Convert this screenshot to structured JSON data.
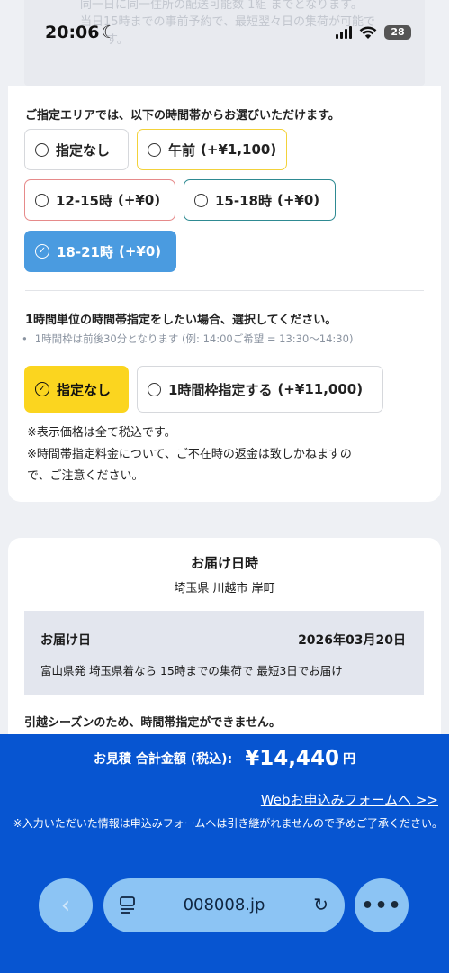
{
  "status_bar": {
    "time": "20:06",
    "moon_icon": "☾",
    "battery": "28"
  },
  "top_faded": {
    "line1": "同一日に同一住所の配送可能数 1組 までとなります。",
    "line2": "当日15時までの事前予約で、最短翌々日の集荷が可能で",
    "line3": "す。"
  },
  "area_time": {
    "heading": "ご指定エリアでは、以下の時間帯からお選びいただけます。",
    "options": [
      {
        "label": "指定なし",
        "price": "",
        "selected": false
      },
      {
        "label": "午前",
        "price": "(+¥1,100)",
        "selected": false
      },
      {
        "label": "12-15時",
        "price": "(+¥0)",
        "selected": false
      },
      {
        "label": "15-18時",
        "price": "(+¥0)",
        "selected": false
      },
      {
        "label": "18-21時",
        "price": "(+¥0)",
        "selected": true
      }
    ]
  },
  "hourly": {
    "heading": "1時間単位の時間帯指定をしたい場合、選択してください。",
    "hint": "1時間枠は前後30分となります (例: 14:00ご希望 = 13:30〜14:30)",
    "options": [
      {
        "label": "指定なし",
        "price": "",
        "selected": true
      },
      {
        "label": "1時間枠指定する",
        "price": "(+¥11,000)",
        "selected": false
      }
    ]
  },
  "notes": {
    "tax": "※表示価格は全て税込です。",
    "refund_line1": "※時間帯指定料金について、ご不在時の返金は致しかねますの",
    "refund_line2": "で、ご注意ください。"
  },
  "delivery": {
    "title": "お届け日時",
    "location": "埼玉県 川越市 岸町",
    "date_label": "お届け日",
    "date_value": "2026年03月20日",
    "date_sub": "富山県発 埼玉県着なら 15時までの集荷で 最短3日でお届け",
    "warning": "引越シーズンのため、時間帯指定ができません。"
  },
  "footer": {
    "total_label": "お見積 合計金額 (税込):",
    "total_amount": "¥14,440",
    "total_unit": "円",
    "web_link": "Webお申込みフォームへ >>",
    "note": "※入力いただいた情報は申込みフォームへは引き継がれませんので予めご了承ください。"
  },
  "browser": {
    "url": "008008.jp",
    "back_icon": "‹",
    "reload_icon": "↻",
    "menu_icon": "•••"
  },
  "colors": {
    "footer_blue": "#0755d1",
    "selected_blue": "#4a9be0",
    "selected_yellow": "#fbd51f",
    "browser_pill": "#8cc4f4"
  }
}
